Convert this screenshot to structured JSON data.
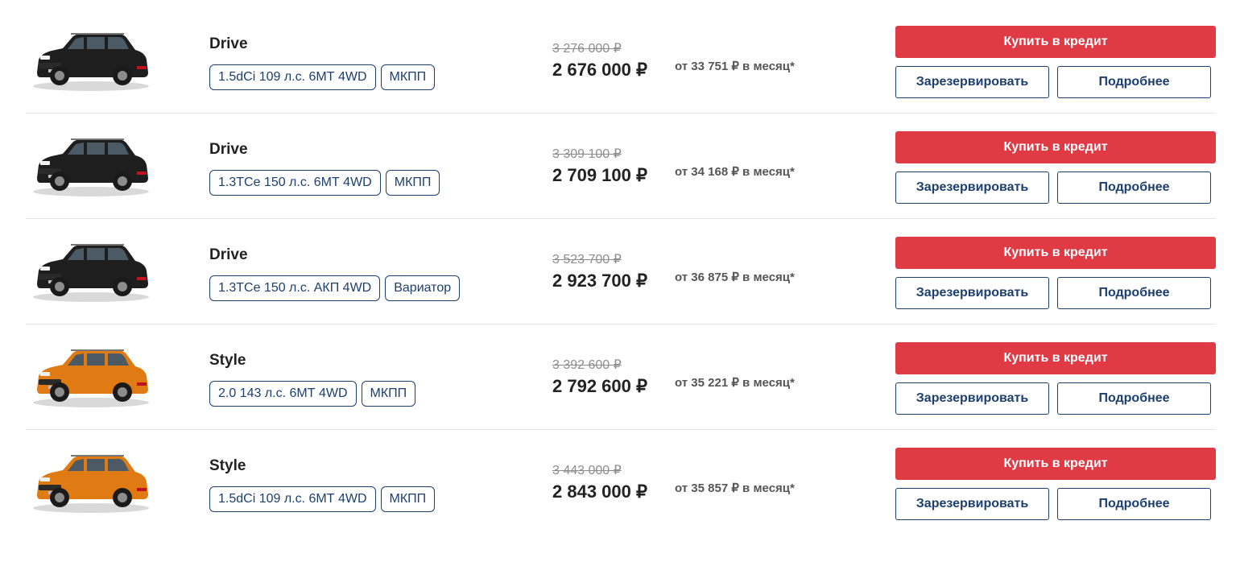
{
  "offers": [
    {
      "trim": "Drive",
      "engine": "1.5dCi 109 л.с. 6МТ 4WD",
      "transmission": "МКПП",
      "old_price": "3 276 000 ₽",
      "price": "2 676 000 ₽",
      "monthly": "от 33 751 ₽ в месяц*",
      "car_color": "#1e1e1e",
      "credit_label": "Купить в кредит",
      "reserve_label": "Зарезервировать",
      "details_label": "Подробнее"
    },
    {
      "trim": "Drive",
      "engine": "1.3TCe 150 л.с. 6МТ 4WD",
      "transmission": "МКПП",
      "old_price": "3 309 100 ₽",
      "price": "2 709 100 ₽",
      "monthly": "от 34 168 ₽ в месяц*",
      "car_color": "#1e1e1e",
      "credit_label": "Купить в кредит",
      "reserve_label": "Зарезервировать",
      "details_label": "Подробнее"
    },
    {
      "trim": "Drive",
      "engine": "1.3TCe 150 л.с. АКП 4WD",
      "transmission": "Вариатор",
      "old_price": "3 523 700 ₽",
      "price": "2 923 700 ₽",
      "monthly": "от 36 875 ₽ в месяц*",
      "car_color": "#1e1e1e",
      "credit_label": "Купить в кредит",
      "reserve_label": "Зарезервировать",
      "details_label": "Подробнее"
    },
    {
      "trim": "Style",
      "engine": "2.0 143 л.с. 6МТ 4WD",
      "transmission": "МКПП",
      "old_price": "3 392 600 ₽",
      "price": "2 792 600 ₽",
      "monthly": "от 35 221 ₽ в месяц*",
      "car_color": "#e07a12",
      "credit_label": "Купить в кредит",
      "reserve_label": "Зарезервировать",
      "details_label": "Подробнее"
    },
    {
      "trim": "Style",
      "engine": "1.5dCi 109 л.с. 6МТ 4WD",
      "transmission": "МКПП",
      "old_price": "3 443 000 ₽",
      "price": "2 843 000 ₽",
      "monthly": "от 35 857 ₽ в месяц*",
      "car_color": "#e07a12",
      "credit_label": "Купить в кредит",
      "reserve_label": "Зарезервировать",
      "details_label": "Подробнее"
    }
  ],
  "colors": {
    "accent_red": "#e03a45",
    "brand_navy": "#1d3f6e"
  }
}
